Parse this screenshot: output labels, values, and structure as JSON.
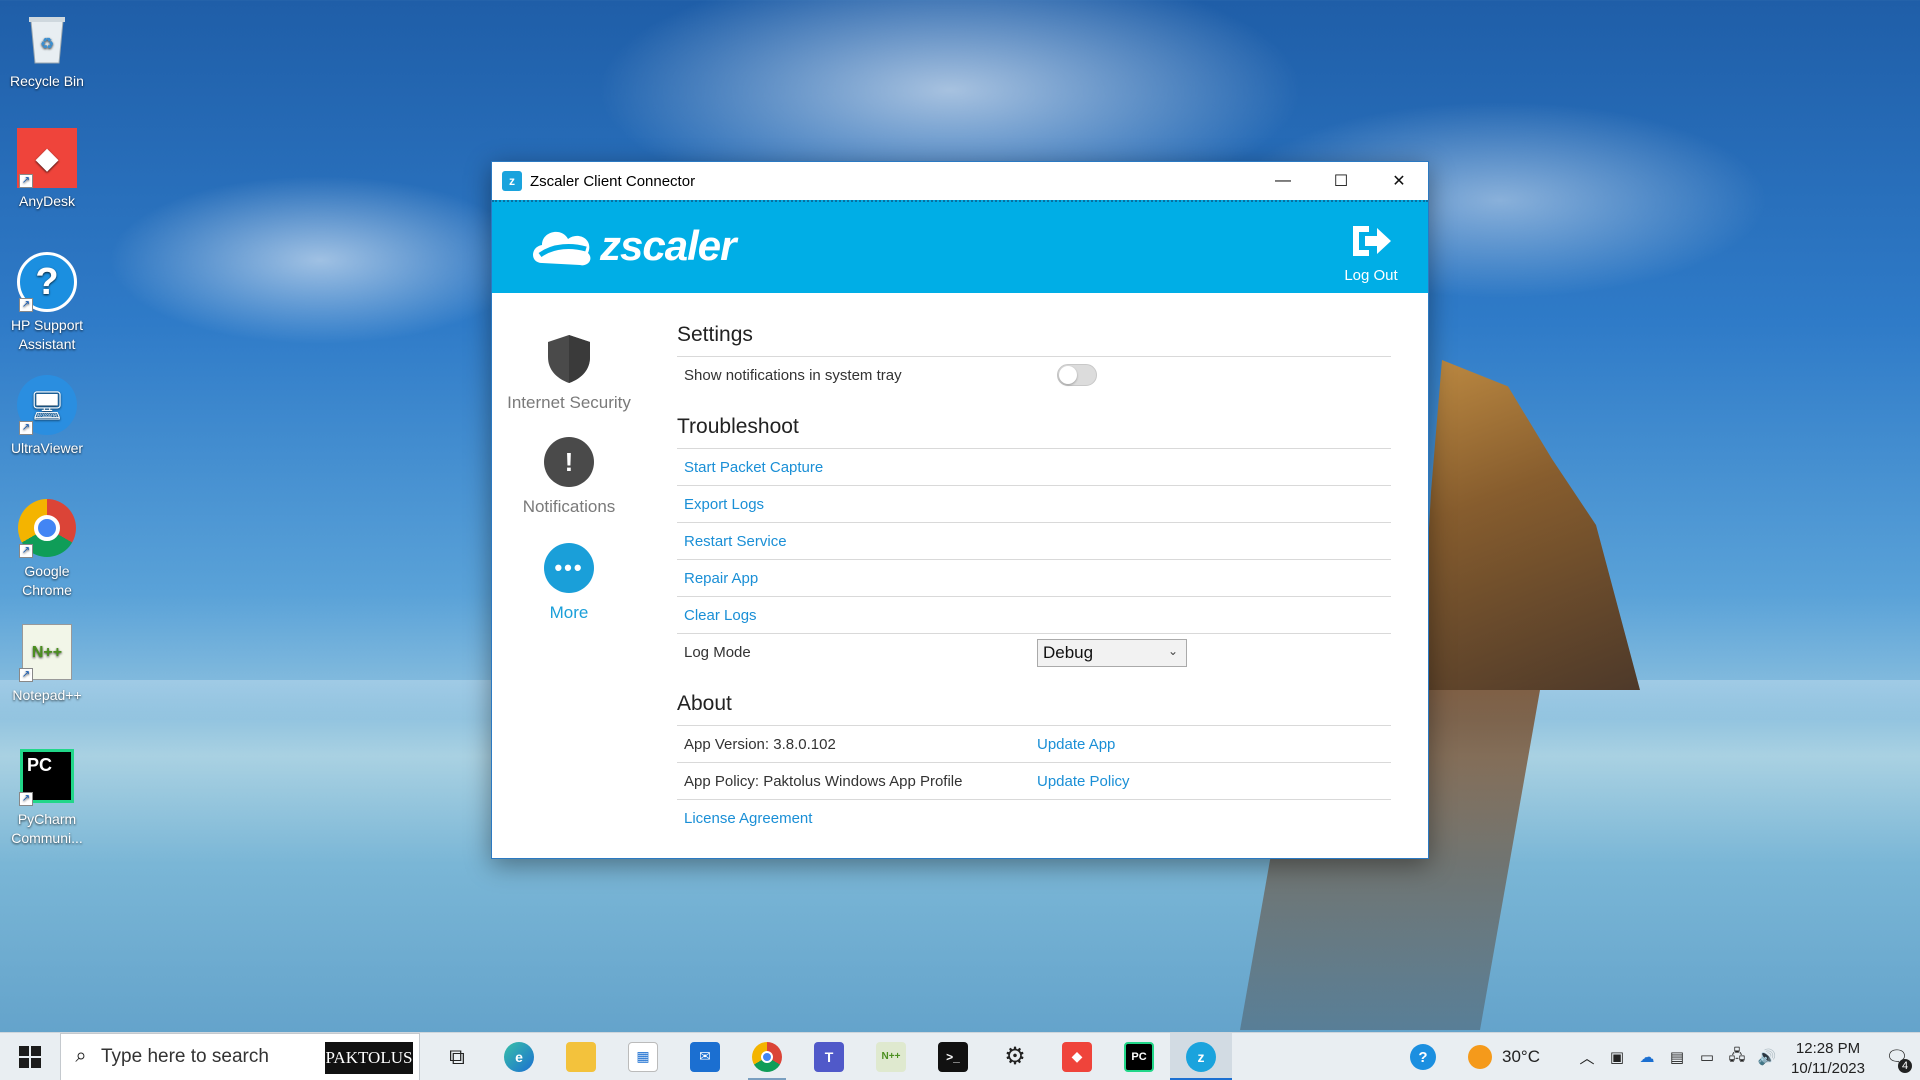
{
  "desktop": {
    "icons": [
      {
        "label": "Recycle Bin",
        "icon": "recycle-bin-icon"
      },
      {
        "label": "AnyDesk",
        "icon": "anydesk-icon"
      },
      {
        "label": "HP Support Assistant",
        "icon": "help-icon"
      },
      {
        "label": "UltraViewer",
        "icon": "monitor-icon"
      },
      {
        "label": "Google Chrome",
        "icon": "chrome-icon"
      },
      {
        "label": "Notepad++",
        "icon": "notepad-icon"
      },
      {
        "label": "PyCharm Communi...",
        "icon": "pycharm-icon"
      }
    ]
  },
  "window": {
    "title": "Zscaler Client Connector",
    "controls": {
      "minimize": "—",
      "maximize": "☐",
      "close": "✕"
    },
    "brand": "zscaler",
    "logout_label": "Log Out",
    "nav": [
      {
        "label": "Internet Security",
        "icon": "shield-icon"
      },
      {
        "label": "Notifications",
        "icon": "exclamation-icon"
      },
      {
        "label": "More",
        "icon": "more-dots-icon"
      }
    ],
    "settings": {
      "title": "Settings",
      "notifications_label": "Show notifications in system tray",
      "notifications_on": false
    },
    "troubleshoot": {
      "title": "Troubleshoot",
      "links": [
        "Start Packet Capture",
        "Export Logs",
        "Restart Service",
        "Repair App",
        "Clear Logs"
      ],
      "log_mode_label": "Log Mode",
      "log_mode_value": "Debug"
    },
    "about": {
      "title": "About",
      "version": "App Version: 3.8.0.102",
      "update_app": "Update App",
      "policy": "App Policy: Paktolus Windows App Profile",
      "update_policy": "Update Policy",
      "license": "License Agreement"
    }
  },
  "taskbar": {
    "search_placeholder": "Type here to search",
    "search_brand": "PAKTOLUS",
    "apps": [
      "task-view-icon",
      "edge-icon",
      "file-explorer-icon",
      "store-icon",
      "mail-icon",
      "chrome-icon",
      "teams-icon",
      "notepad-icon",
      "terminal-icon",
      "settings-icon",
      "anydesk-icon",
      "pycharm-icon",
      "zscaler-icon"
    ],
    "weather": "30°C",
    "time": "12:28 PM",
    "date": "10/11/2023",
    "notification_count": "4"
  },
  "colors": {
    "accent": "#00aee6",
    "link": "#1a8fd6"
  }
}
